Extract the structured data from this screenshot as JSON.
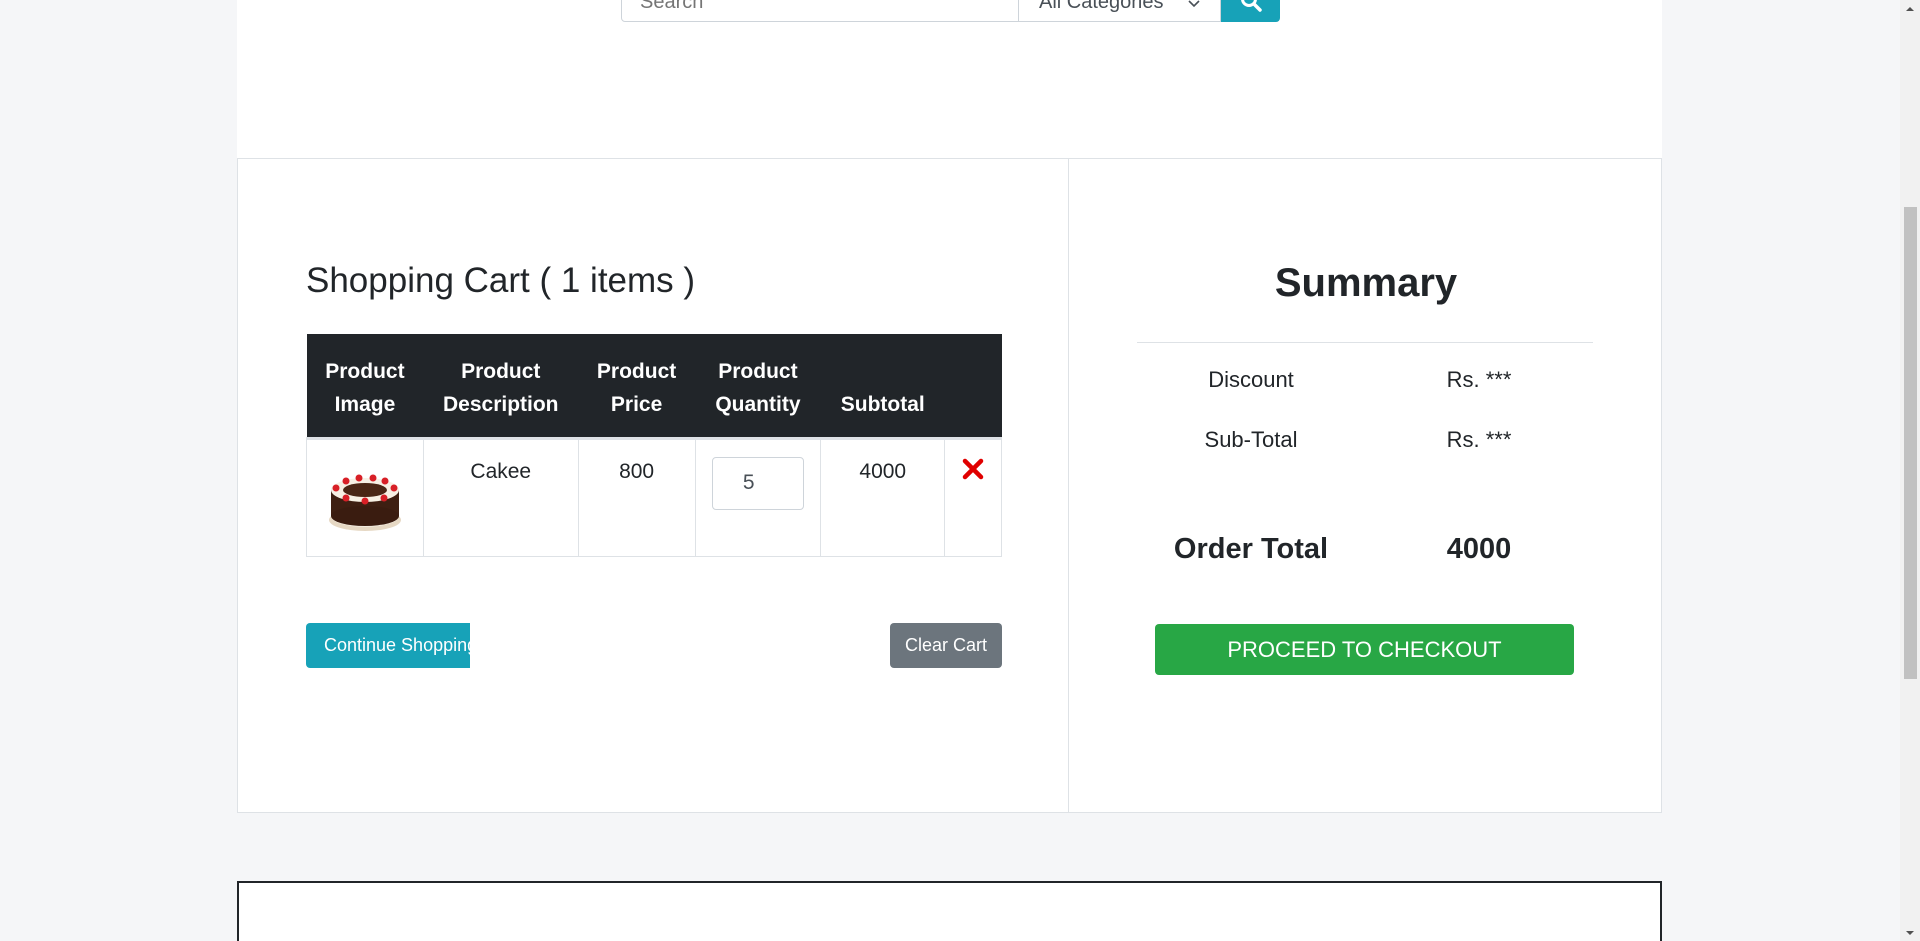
{
  "search": {
    "placeholder": "Search",
    "category": "All Categories"
  },
  "cart": {
    "title": "Shopping Cart ( 1 items )",
    "headers": {
      "image": [
        "Product",
        "Image"
      ],
      "description": [
        "Product",
        "Description"
      ],
      "price": [
        "Product",
        "Price"
      ],
      "quantity": [
        "Product",
        "Quantity"
      ],
      "subtotal": "Subtotal"
    },
    "items": [
      {
        "description": "Cakee",
        "price": "800",
        "quantity": "5",
        "subtotal": "4000",
        "image_icon": "cake-image"
      }
    ],
    "continue_label": "Continue Shopping",
    "clear_label": "Clear Cart",
    "remove_icon": "close-x-icon",
    "remove_color": "#e00000"
  },
  "summary": {
    "title": "Summary",
    "discount_label": "Discount",
    "discount_value": "Rs. ***",
    "subtotal_label": "Sub-Total",
    "subtotal_value": "Rs. ***",
    "total_label": "Order Total",
    "total_value": "4000",
    "checkout_label": "PROCEED TO CHECKOUT"
  },
  "colors": {
    "accent": "#17a2b8",
    "dark": "#212529",
    "checkout": "#28a745",
    "secondary": "#6c757d"
  }
}
